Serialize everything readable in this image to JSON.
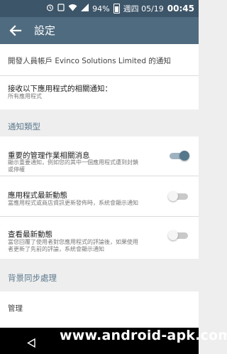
{
  "status_bar": {
    "battery": "94%",
    "date": "週四 05/19",
    "time": "00:45"
  },
  "toolbar": {
    "title": "設定"
  },
  "developer_notice": "開發人員帳戶 Evinco Solutions Limited 的通知",
  "receive_notifications": {
    "title": "接收以下應用程式的相關通知：",
    "value": "所有應用程式"
  },
  "sections": {
    "notification_types": "通知類型",
    "background_sync": "背景同步處理"
  },
  "notification_items": [
    {
      "title": "重要的管理作業相關消息",
      "desc_line1": "顯示重要通知，例如您的其中一個應用程式遭到封鎖",
      "desc_line2": "或停權",
      "enabled": true
    },
    {
      "title": "應用程式最新動態",
      "desc_line1": "當應用程式或商店資訊更新發佈時，系統會顯示通知",
      "desc_line2": "",
      "enabled": false
    },
    {
      "title": "查看最新動態",
      "desc_line1": "當您回覆了使用者對您應用程式的評論後，如果使用",
      "desc_line2": "者更新了先前的評論，系統會顯示通知",
      "enabled": false
    }
  ],
  "manage": "管理",
  "watermark": "www.android-apk.com",
  "colors": {
    "status_bar": "#3d5568",
    "toolbar": "#4f6b7f",
    "section_text": "#5d7a8e",
    "switch_on": "#56788c"
  }
}
